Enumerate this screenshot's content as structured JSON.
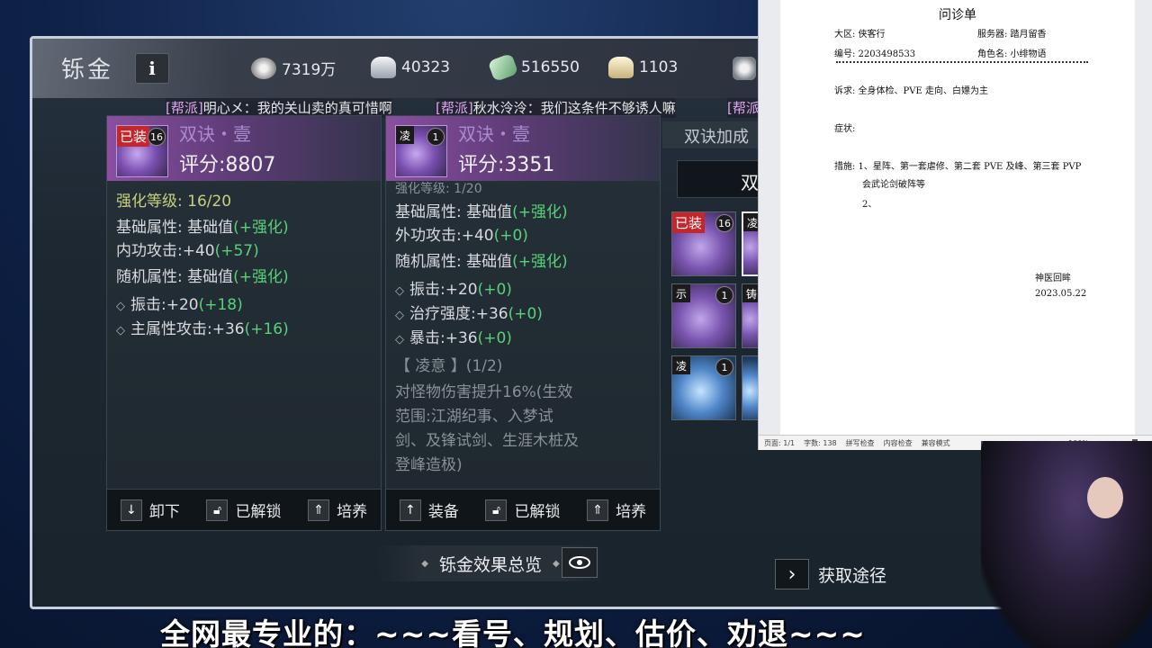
{
  "game": {
    "title": "铄金",
    "info_label": "i",
    "currencies": [
      {
        "icon": "coin-icon",
        "value": "7319万"
      },
      {
        "icon": "silver-ingot-icon",
        "value": "40323"
      },
      {
        "icon": "jade-icon",
        "value": "516550"
      },
      {
        "icon": "gold-ingot-icon",
        "value": "1103"
      }
    ],
    "ticker": [
      {
        "tag": "[帮派]",
        "text": "明心メ：我的关山卖的真可惜啊"
      },
      {
        "tag": "[帮派]",
        "text": "秋水泠泠：我们这条件不够诱人嘛"
      },
      {
        "tag": "[帮派",
        "text": ""
      }
    ],
    "left_card": {
      "equipped": "已装",
      "level": "16",
      "name": "双诀・壹",
      "score": "评分:8807",
      "enhance": "强化等级:  16/20",
      "base_label": "基础属性:  基础值",
      "base_green": "(+强化)",
      "attack": "内功攻击:+40",
      "attack_green": "(+57)",
      "random_label": "随机属性:  基础值",
      "random_green": "(+强化)",
      "stat1": "振击:+20",
      "stat1_green": "(+18)",
      "stat2": "主属性攻击:+36",
      "stat2_green": "(+16)",
      "btn1": "卸下",
      "btn2": "已解锁",
      "btn3": "培养"
    },
    "right_card": {
      "mark": "凌",
      "level": "1",
      "name": "双诀・壹",
      "score": "评分:3351",
      "enhance": "强化等级: 1/20",
      "base_label": "基础属性:  基础值",
      "base_green": "(+强化)",
      "attack": "外功攻击:+40",
      "attack_green": "(+0)",
      "random_label": "随机属性:  基础值",
      "random_green": "(+强化)",
      "stat1": "振击:+20",
      "stat1_green": "(+0)",
      "stat2": "治疗强度:+36",
      "stat2_green": "(+0)",
      "stat3": "暴击:+36",
      "stat3_green": "(+0)",
      "set_title": "【 凌意 】(1/2)",
      "set_desc1": "对怪物伤害提升16%(生效",
      "set_desc2": "范围:江湖纪事、入梦试",
      "set_desc3": "剑、及锋试剑、生涯木桩及",
      "set_desc4": "登峰造极)",
      "btn1": "装备",
      "btn2": "已解锁",
      "btn3": "培养"
    },
    "side": {
      "title": "双诀加成",
      "tab": "双",
      "slots": [
        {
          "tag": "已装",
          "level": "16"
        },
        {
          "tag": "凌",
          "level": ""
        },
        {
          "tag": "示",
          "level": "1"
        },
        {
          "tag": "铸",
          "level": ""
        },
        {
          "tag": "凌",
          "level": "1"
        }
      ]
    },
    "overview_label": "铄金效果总览",
    "get_way_label": "获取途径"
  },
  "doc": {
    "title": "问诊单",
    "region_label": "大区:  侠客行",
    "server_label": "服务器:  踏月留香",
    "id_label": "编号:  2203498533",
    "role_label": "角色名:  小绯物语",
    "appeal": "诉求:  全身体检、PVE 走向、白嫖为主",
    "symptom": "症状:",
    "measure1": "措施:  1、星阵、第一套虐修、第二套 PVE 及峰、第三套 PVP",
    "measure2": "会武论剑破阵等",
    "measure3": "2、",
    "sign": "神医回眸",
    "date": "2023.05.22",
    "status_page": "页面: 1/1",
    "status_words": "字数: 138",
    "status_spell": "拼写检查",
    "status_content": "内容检查",
    "status_mode": "兼容模式",
    "zoom": "100%"
  },
  "banner": "全网最专业的：~~~看号、规划、估价、劝退~~~"
}
